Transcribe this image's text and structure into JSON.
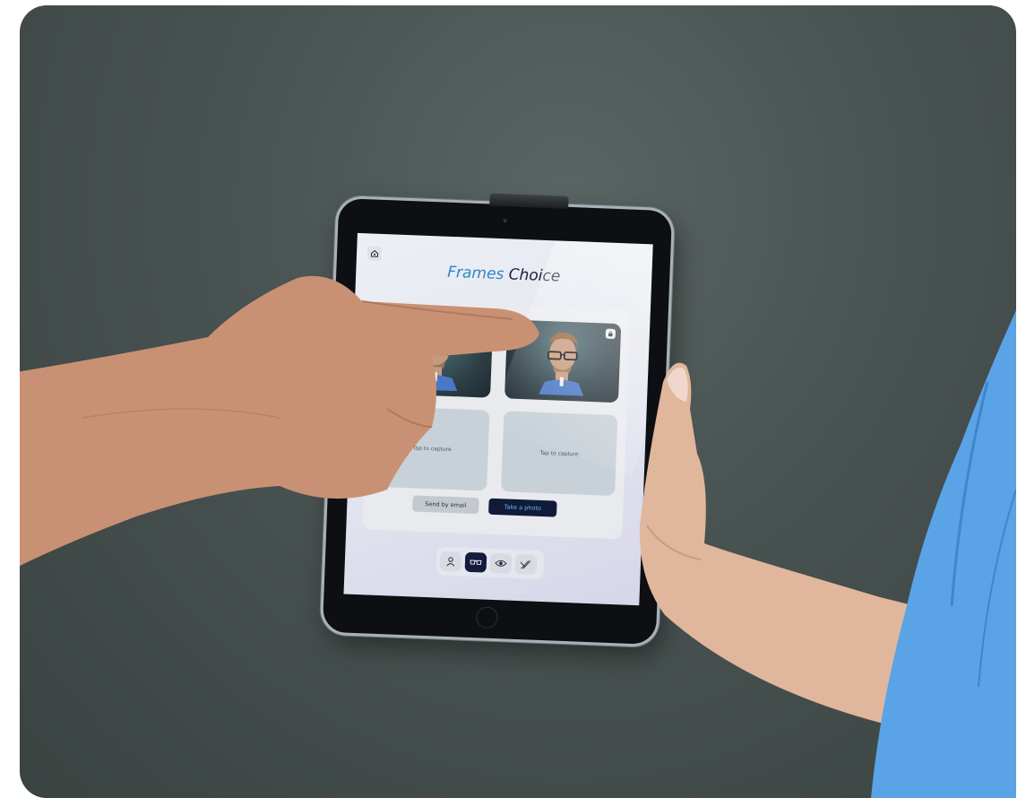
{
  "app": {
    "title_part1": "Frames",
    "title_part2": "Choice"
  },
  "gallery": {
    "tiles": [
      {
        "kind": "photo"
      },
      {
        "kind": "photo"
      },
      {
        "kind": "capture",
        "label": "Tap to capture"
      },
      {
        "kind": "capture",
        "label": "Tap to capture"
      }
    ]
  },
  "actions": {
    "send_email_label": "Send by email",
    "take_photo_label": "Take a photo"
  },
  "tabbar": {
    "tabs": [
      {
        "icon": "person-icon",
        "active": false
      },
      {
        "icon": "glasses-icon",
        "active": true
      },
      {
        "icon": "eye-icon",
        "active": false
      },
      {
        "icon": "measure-icon",
        "active": false
      }
    ]
  },
  "colors": {
    "accent_blue": "#2f86c8",
    "title_dark": "#1c1e3a",
    "primary_button": "#121a3a",
    "primary_button_text": "#5fc3ff",
    "background": "#485250",
    "sleeve": "#5aa3e6"
  }
}
